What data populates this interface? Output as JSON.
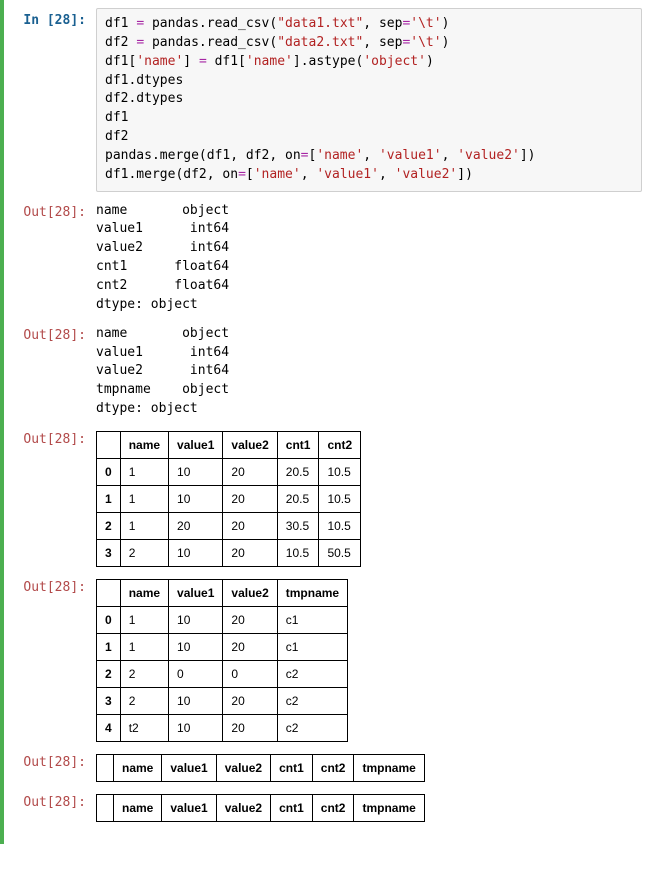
{
  "input_prompt": "In [28]:",
  "output_prompt": "Out[28]:",
  "code": {
    "l1a": "df1 ",
    "l1b": "=",
    "l1c": " pandas.read_csv(",
    "l1s": "\"data1.txt\"",
    "l1d": ", sep",
    "l1e": "=",
    "l1f": "'\\t'",
    "l1g": ")",
    "l2a": "df2 ",
    "l2b": "=",
    "l2c": " pandas.read_csv(",
    "l2s": "\"data2.txt\"",
    "l2d": ", sep",
    "l2e": "=",
    "l2f": "'\\t'",
    "l2g": ")",
    "l3a": "df1[",
    "l3s": "'name'",
    "l3b": "] ",
    "l3c": "=",
    "l3d": " df1[",
    "l3t": "'name'",
    "l3e": "].astype(",
    "l3u": "'object'",
    "l3f": ")",
    "l4": "df1.dtypes",
    "l5": "df2.dtypes",
    "l6": "df1",
    "l7": "df2",
    "l8a": "pandas.merge(df1, df2, on",
    "l8b": "=",
    "l8c": "[",
    "l8s1": "'name'",
    "l8d": ", ",
    "l8s2": "'value1'",
    "l8e": ", ",
    "l8s3": "'value2'",
    "l8f": "])",
    "l9a": "df1.merge(df2, on",
    "l9b": "=",
    "l9c": "[",
    "l9s1": "'name'",
    "l9d": ", ",
    "l9s2": "'value1'",
    "l9e": ", ",
    "l9s3": "'value2'",
    "l9f": "])"
  },
  "dtypes1": "name       object\nvalue1      int64\nvalue2      int64\ncnt1      float64\ncnt2      float64\ndtype: object",
  "dtypes2": "name       object\nvalue1      int64\nvalue2      int64\ntmpname    object\ndtype: object",
  "chart_data": [
    {
      "type": "table",
      "columns": [
        "",
        "name",
        "value1",
        "value2",
        "cnt1",
        "cnt2"
      ],
      "rows": [
        [
          "0",
          "1",
          "10",
          "20",
          "20.5",
          "10.5"
        ],
        [
          "1",
          "1",
          "10",
          "20",
          "20.5",
          "10.5"
        ],
        [
          "2",
          "1",
          "20",
          "20",
          "30.5",
          "10.5"
        ],
        [
          "3",
          "2",
          "10",
          "20",
          "10.5",
          "50.5"
        ]
      ]
    },
    {
      "type": "table",
      "columns": [
        "",
        "name",
        "value1",
        "value2",
        "tmpname"
      ],
      "rows": [
        [
          "0",
          "1",
          "10",
          "20",
          "c1"
        ],
        [
          "1",
          "1",
          "10",
          "20",
          "c1"
        ],
        [
          "2",
          "2",
          "0",
          "0",
          "c2"
        ],
        [
          "3",
          "2",
          "10",
          "20",
          "c2"
        ],
        [
          "4",
          "t2",
          "10",
          "20",
          "c2"
        ]
      ]
    },
    {
      "type": "table",
      "columns": [
        "",
        "name",
        "value1",
        "value2",
        "cnt1",
        "cnt2",
        "tmpname"
      ],
      "rows": []
    },
    {
      "type": "table",
      "columns": [
        "",
        "name",
        "value1",
        "value2",
        "cnt1",
        "cnt2",
        "tmpname"
      ],
      "rows": []
    }
  ]
}
